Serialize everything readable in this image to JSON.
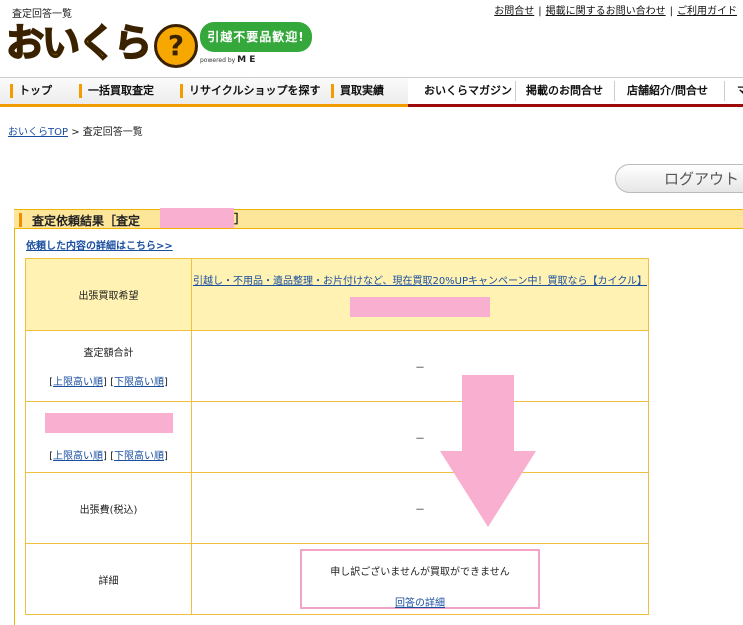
{
  "page": {
    "caption": "査定回答一覧"
  },
  "header": {
    "links": [
      "お問合せ",
      "掲載に関するお問い合わせ",
      "ご利用ガイド"
    ],
    "logo_text": "おいくら",
    "logo_q": "?",
    "badge": "引越不要品歓迎!",
    "powered_by": "powered by",
    "powered_brand": "M E"
  },
  "nav": {
    "items": [
      "トップ",
      "一括買取査定",
      "リサイクルショップを探す",
      "買取実績",
      "おいくらマガジン",
      "掲載のお問合せ",
      "店舗紹介/問合せ",
      "マ"
    ]
  },
  "breadcrumb": {
    "home": "おいくらTOP",
    "sep": " > ",
    "current": "査定回答一覧"
  },
  "logout": {
    "label": "ログアウト"
  },
  "section": {
    "title": "査定依頼結果［査定",
    "title_close": "］"
  },
  "detail_link": "依頼した内容の詳細はこちら>>",
  "table": {
    "rows": [
      {
        "label": "出張買取希望",
        "value": "引越し・不用品・遺品整理・お片付けなど、現在買取20%UPキャンペーン中！買取なら【カイクル】"
      },
      {
        "label": "査定額合計",
        "value": "－"
      },
      {
        "label": "",
        "value": "－"
      },
      {
        "label": "出張費(税込)",
        "value": "－"
      },
      {
        "label": "詳細",
        "value": "申し訳ございませんが買取ができません"
      }
    ],
    "sort_left": "[",
    "sort_high": "上限高い順",
    "sort_mid": "] [",
    "sort_low": "下限高い順",
    "sort_right": "]",
    "answer_detail": "回答の詳細"
  },
  "colors": {
    "accent": "#f39c00",
    "nav_border_right": "#9c0a0a",
    "highlight": "#f9afd0",
    "link": "#1a4fa0"
  }
}
